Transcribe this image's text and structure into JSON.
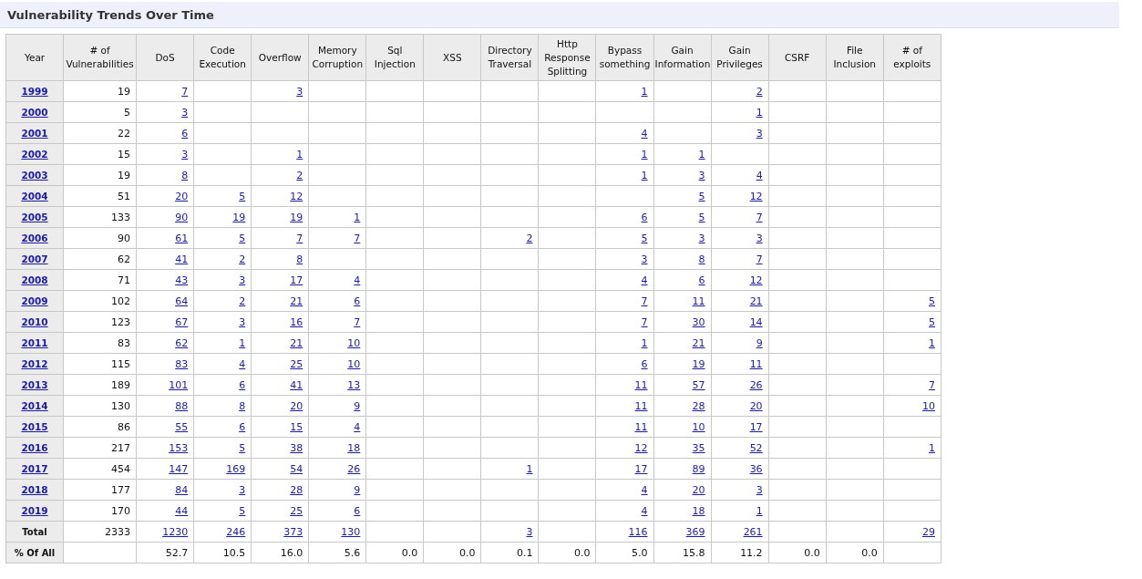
{
  "title": "Vulnerability Trends Over Time",
  "table": {
    "columns": [
      "Year",
      "# of Vulnerabilities",
      "DoS",
      "Code Execution",
      "Overflow",
      "Memory Corruption",
      "Sql Injection",
      "XSS",
      "Directory Traversal",
      "Http Response Splitting",
      "Bypass something",
      "Gain Information",
      "Gain Privileges",
      "CSRF",
      "File Inclusion",
      "# of exploits"
    ],
    "rows": [
      {
        "kind": "year",
        "cells": [
          {
            "text": "1999",
            "link": true
          },
          {
            "text": "19",
            "link": false
          },
          {
            "text": "7",
            "link": true
          },
          null,
          {
            "text": "3",
            "link": true
          },
          null,
          null,
          null,
          null,
          null,
          {
            "text": "1",
            "link": true
          },
          null,
          {
            "text": "2",
            "link": true
          },
          null,
          null,
          null
        ]
      },
      {
        "kind": "year",
        "cells": [
          {
            "text": "2000",
            "link": true
          },
          {
            "text": "5",
            "link": false
          },
          {
            "text": "3",
            "link": true
          },
          null,
          null,
          null,
          null,
          null,
          null,
          null,
          null,
          null,
          {
            "text": "1",
            "link": true
          },
          null,
          null,
          null
        ]
      },
      {
        "kind": "year",
        "cells": [
          {
            "text": "2001",
            "link": true
          },
          {
            "text": "22",
            "link": false
          },
          {
            "text": "6",
            "link": true
          },
          null,
          null,
          null,
          null,
          null,
          null,
          null,
          {
            "text": "4",
            "link": true
          },
          null,
          {
            "text": "3",
            "link": true
          },
          null,
          null,
          null
        ]
      },
      {
        "kind": "year",
        "cells": [
          {
            "text": "2002",
            "link": true
          },
          {
            "text": "15",
            "link": false
          },
          {
            "text": "3",
            "link": true
          },
          null,
          {
            "text": "1",
            "link": true
          },
          null,
          null,
          null,
          null,
          null,
          {
            "text": "1",
            "link": true
          },
          {
            "text": "1",
            "link": true
          },
          null,
          null,
          null,
          null
        ]
      },
      {
        "kind": "year",
        "cells": [
          {
            "text": "2003",
            "link": true
          },
          {
            "text": "19",
            "link": false
          },
          {
            "text": "8",
            "link": true
          },
          null,
          {
            "text": "2",
            "link": true
          },
          null,
          null,
          null,
          null,
          null,
          {
            "text": "1",
            "link": true
          },
          {
            "text": "3",
            "link": true
          },
          {
            "text": "4",
            "link": true
          },
          null,
          null,
          null
        ]
      },
      {
        "kind": "year",
        "cells": [
          {
            "text": "2004",
            "link": true
          },
          {
            "text": "51",
            "link": false
          },
          {
            "text": "20",
            "link": true
          },
          {
            "text": "5",
            "link": true
          },
          {
            "text": "12",
            "link": true
          },
          null,
          null,
          null,
          null,
          null,
          null,
          {
            "text": "5",
            "link": true
          },
          {
            "text": "12",
            "link": true
          },
          null,
          null,
          null
        ]
      },
      {
        "kind": "year",
        "cells": [
          {
            "text": "2005",
            "link": true
          },
          {
            "text": "133",
            "link": false
          },
          {
            "text": "90",
            "link": true
          },
          {
            "text": "19",
            "link": true
          },
          {
            "text": "19",
            "link": true
          },
          {
            "text": "1",
            "link": true
          },
          null,
          null,
          null,
          null,
          {
            "text": "6",
            "link": true
          },
          {
            "text": "5",
            "link": true
          },
          {
            "text": "7",
            "link": true
          },
          null,
          null,
          null
        ]
      },
      {
        "kind": "year",
        "cells": [
          {
            "text": "2006",
            "link": true
          },
          {
            "text": "90",
            "link": false
          },
          {
            "text": "61",
            "link": true
          },
          {
            "text": "5",
            "link": true
          },
          {
            "text": "7",
            "link": true
          },
          {
            "text": "7",
            "link": true
          },
          null,
          null,
          {
            "text": "2",
            "link": true
          },
          null,
          {
            "text": "5",
            "link": true
          },
          {
            "text": "3",
            "link": true
          },
          {
            "text": "3",
            "link": true
          },
          null,
          null,
          null
        ]
      },
      {
        "kind": "year",
        "cells": [
          {
            "text": "2007",
            "link": true
          },
          {
            "text": "62",
            "link": false
          },
          {
            "text": "41",
            "link": true
          },
          {
            "text": "2",
            "link": true
          },
          {
            "text": "8",
            "link": true
          },
          null,
          null,
          null,
          null,
          null,
          {
            "text": "3",
            "link": true
          },
          {
            "text": "8",
            "link": true
          },
          {
            "text": "7",
            "link": true
          },
          null,
          null,
          null
        ]
      },
      {
        "kind": "year",
        "cells": [
          {
            "text": "2008",
            "link": true
          },
          {
            "text": "71",
            "link": false
          },
          {
            "text": "43",
            "link": true
          },
          {
            "text": "3",
            "link": true
          },
          {
            "text": "17",
            "link": true
          },
          {
            "text": "4",
            "link": true
          },
          null,
          null,
          null,
          null,
          {
            "text": "4",
            "link": true
          },
          {
            "text": "6",
            "link": true
          },
          {
            "text": "12",
            "link": true
          },
          null,
          null,
          null
        ]
      },
      {
        "kind": "year",
        "cells": [
          {
            "text": "2009",
            "link": true
          },
          {
            "text": "102",
            "link": false
          },
          {
            "text": "64",
            "link": true
          },
          {
            "text": "2",
            "link": true
          },
          {
            "text": "21",
            "link": true
          },
          {
            "text": "6",
            "link": true
          },
          null,
          null,
          null,
          null,
          {
            "text": "7",
            "link": true
          },
          {
            "text": "11",
            "link": true
          },
          {
            "text": "21",
            "link": true
          },
          null,
          null,
          {
            "text": "5",
            "link": true
          }
        ]
      },
      {
        "kind": "year",
        "cells": [
          {
            "text": "2010",
            "link": true
          },
          {
            "text": "123",
            "link": false
          },
          {
            "text": "67",
            "link": true
          },
          {
            "text": "3",
            "link": true
          },
          {
            "text": "16",
            "link": true
          },
          {
            "text": "7",
            "link": true
          },
          null,
          null,
          null,
          null,
          {
            "text": "7",
            "link": true
          },
          {
            "text": "30",
            "link": true
          },
          {
            "text": "14",
            "link": true
          },
          null,
          null,
          {
            "text": "5",
            "link": true
          }
        ]
      },
      {
        "kind": "year",
        "cells": [
          {
            "text": "2011",
            "link": true
          },
          {
            "text": "83",
            "link": false
          },
          {
            "text": "62",
            "link": true
          },
          {
            "text": "1",
            "link": true
          },
          {
            "text": "21",
            "link": true
          },
          {
            "text": "10",
            "link": true
          },
          null,
          null,
          null,
          null,
          {
            "text": "1",
            "link": true
          },
          {
            "text": "21",
            "link": true
          },
          {
            "text": "9",
            "link": true
          },
          null,
          null,
          {
            "text": "1",
            "link": true
          }
        ]
      },
      {
        "kind": "year",
        "cells": [
          {
            "text": "2012",
            "link": true
          },
          {
            "text": "115",
            "link": false
          },
          {
            "text": "83",
            "link": true
          },
          {
            "text": "4",
            "link": true
          },
          {
            "text": "25",
            "link": true
          },
          {
            "text": "10",
            "link": true
          },
          null,
          null,
          null,
          null,
          {
            "text": "6",
            "link": true
          },
          {
            "text": "19",
            "link": true
          },
          {
            "text": "11",
            "link": true
          },
          null,
          null,
          null
        ]
      },
      {
        "kind": "year",
        "cells": [
          {
            "text": "2013",
            "link": true
          },
          {
            "text": "189",
            "link": false
          },
          {
            "text": "101",
            "link": true
          },
          {
            "text": "6",
            "link": true
          },
          {
            "text": "41",
            "link": true
          },
          {
            "text": "13",
            "link": true
          },
          null,
          null,
          null,
          null,
          {
            "text": "11",
            "link": true
          },
          {
            "text": "57",
            "link": true
          },
          {
            "text": "26",
            "link": true
          },
          null,
          null,
          {
            "text": "7",
            "link": true
          }
        ]
      },
      {
        "kind": "year",
        "cells": [
          {
            "text": "2014",
            "link": true
          },
          {
            "text": "130",
            "link": false
          },
          {
            "text": "88",
            "link": true
          },
          {
            "text": "8",
            "link": true
          },
          {
            "text": "20",
            "link": true
          },
          {
            "text": "9",
            "link": true
          },
          null,
          null,
          null,
          null,
          {
            "text": "11",
            "link": true
          },
          {
            "text": "28",
            "link": true
          },
          {
            "text": "20",
            "link": true
          },
          null,
          null,
          {
            "text": "10",
            "link": true
          }
        ]
      },
      {
        "kind": "year",
        "cells": [
          {
            "text": "2015",
            "link": true
          },
          {
            "text": "86",
            "link": false
          },
          {
            "text": "55",
            "link": true
          },
          {
            "text": "6",
            "link": true
          },
          {
            "text": "15",
            "link": true
          },
          {
            "text": "4",
            "link": true
          },
          null,
          null,
          null,
          null,
          {
            "text": "11",
            "link": true
          },
          {
            "text": "10",
            "link": true
          },
          {
            "text": "17",
            "link": true
          },
          null,
          null,
          null
        ]
      },
      {
        "kind": "year",
        "cells": [
          {
            "text": "2016",
            "link": true
          },
          {
            "text": "217",
            "link": false
          },
          {
            "text": "153",
            "link": true
          },
          {
            "text": "5",
            "link": true
          },
          {
            "text": "38",
            "link": true
          },
          {
            "text": "18",
            "link": true
          },
          null,
          null,
          null,
          null,
          {
            "text": "12",
            "link": true
          },
          {
            "text": "35",
            "link": true
          },
          {
            "text": "52",
            "link": true
          },
          null,
          null,
          {
            "text": "1",
            "link": true
          }
        ]
      },
      {
        "kind": "year",
        "cells": [
          {
            "text": "2017",
            "link": true
          },
          {
            "text": "454",
            "link": false
          },
          {
            "text": "147",
            "link": true
          },
          {
            "text": "169",
            "link": true
          },
          {
            "text": "54",
            "link": true
          },
          {
            "text": "26",
            "link": true
          },
          null,
          null,
          {
            "text": "1",
            "link": true
          },
          null,
          {
            "text": "17",
            "link": true
          },
          {
            "text": "89",
            "link": true
          },
          {
            "text": "36",
            "link": true
          },
          null,
          null,
          null
        ]
      },
      {
        "kind": "year",
        "cells": [
          {
            "text": "2018",
            "link": true
          },
          {
            "text": "177",
            "link": false
          },
          {
            "text": "84",
            "link": true
          },
          {
            "text": "3",
            "link": true
          },
          {
            "text": "28",
            "link": true
          },
          {
            "text": "9",
            "link": true
          },
          null,
          null,
          null,
          null,
          {
            "text": "4",
            "link": true
          },
          {
            "text": "20",
            "link": true
          },
          {
            "text": "3",
            "link": true
          },
          null,
          null,
          null
        ]
      },
      {
        "kind": "year",
        "cells": [
          {
            "text": "2019",
            "link": true
          },
          {
            "text": "170",
            "link": false
          },
          {
            "text": "44",
            "link": true
          },
          {
            "text": "5",
            "link": true
          },
          {
            "text": "25",
            "link": true
          },
          {
            "text": "6",
            "link": true
          },
          null,
          null,
          null,
          null,
          {
            "text": "4",
            "link": true
          },
          {
            "text": "18",
            "link": true
          },
          {
            "text": "1",
            "link": true
          },
          null,
          null,
          null
        ]
      },
      {
        "kind": "total",
        "cells": [
          {
            "text": "Total",
            "link": false
          },
          {
            "text": "2333",
            "link": false
          },
          {
            "text": "1230",
            "link": true
          },
          {
            "text": "246",
            "link": true
          },
          {
            "text": "373",
            "link": true
          },
          {
            "text": "130",
            "link": true
          },
          null,
          null,
          {
            "text": "3",
            "link": true
          },
          null,
          {
            "text": "116",
            "link": true
          },
          {
            "text": "369",
            "link": true
          },
          {
            "text": "261",
            "link": true
          },
          null,
          null,
          {
            "text": "29",
            "link": true
          }
        ]
      },
      {
        "kind": "percent",
        "cells": [
          {
            "text": "% Of All",
            "link": false
          },
          null,
          {
            "text": "52.7",
            "link": false
          },
          {
            "text": "10.5",
            "link": false
          },
          {
            "text": "16.0",
            "link": false
          },
          {
            "text": "5.6",
            "link": false
          },
          {
            "text": "0.0",
            "link": false
          },
          {
            "text": "0.0",
            "link": false
          },
          {
            "text": "0.1",
            "link": false
          },
          {
            "text": "0.0",
            "link": false
          },
          {
            "text": "5.0",
            "link": false
          },
          {
            "text": "15.8",
            "link": false
          },
          {
            "text": "11.2",
            "link": false
          },
          {
            "text": "0.0",
            "link": false
          },
          {
            "text": "0.0",
            "link": false
          },
          null
        ]
      }
    ]
  }
}
